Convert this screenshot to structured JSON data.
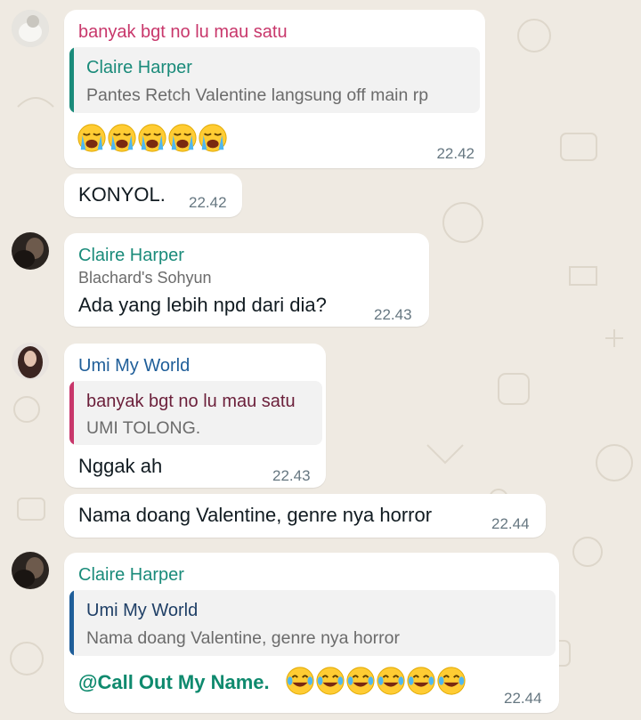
{
  "colors": {
    "chat_bg": "#efeae2",
    "sender_pink": "#c8376b",
    "sender_teal": "#1a8b7a",
    "sender_blue": "#1f5e99",
    "quote_bar_teal": "#1a8b7a",
    "quote_bar_pink": "#c8376b",
    "quote_bar_blue": "#1f5e99",
    "mention_green": "#0f8a6e"
  },
  "messages": [
    {
      "sender": "banyak bgt no lu mau satu",
      "quote": {
        "name": "Claire Harper",
        "text": "Pantes Retch Valentine langsung off main rp"
      },
      "emojis": [
        "loudly-crying-face",
        "loudly-crying-face",
        "loudly-crying-face",
        "loudly-crying-face",
        "loudly-crying-face"
      ],
      "time": "22.42"
    },
    {
      "text": "KONYOL.",
      "time": "22.42"
    },
    {
      "sender": "Claire Harper",
      "subtitle": "Blachard's Sohyun",
      "text": "Ada yang lebih npd dari dia?",
      "time": "22.43"
    },
    {
      "sender": "Umi My World",
      "quote": {
        "name": "banyak bgt no lu mau satu",
        "text": "UMI TOLONG."
      },
      "text": "Nggak ah",
      "time": "22.43"
    },
    {
      "text": "Nama doang Valentine, genre nya horror",
      "time": "22.44"
    },
    {
      "sender": "Claire Harper",
      "quote": {
        "name": "Umi My World",
        "text": "Nama doang Valentine, genre nya horror"
      },
      "mention": "@Call Out My Name.",
      "emojis": [
        "face-with-tears-of-joy",
        "face-with-tears-of-joy",
        "face-with-tears-of-joy",
        "face-with-tears-of-joy",
        "face-with-tears-of-joy",
        "face-with-tears-of-joy"
      ],
      "time": "22.44"
    }
  ]
}
